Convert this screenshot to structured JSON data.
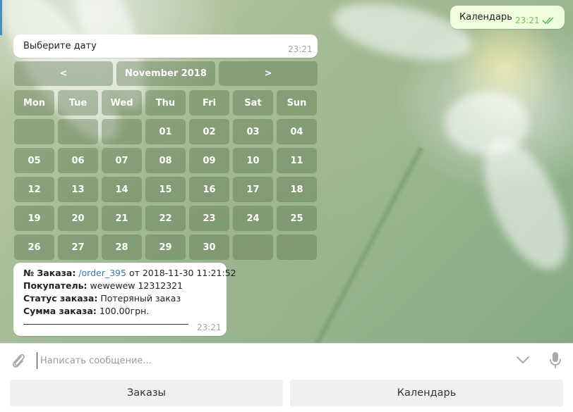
{
  "outgoing": {
    "text": "Календарь",
    "time": "23:21",
    "status_icon": "double-check-icon"
  },
  "prompt_message": {
    "text": "Выберите дату",
    "time": "23:21"
  },
  "calendar": {
    "prev": "<",
    "month": "November 2018",
    "next": ">",
    "weekdays": [
      "Mon",
      "Tue",
      "Wed",
      "Thu",
      "Fri",
      "Sat",
      "Sun"
    ],
    "weeks": [
      [
        "",
        "",
        "",
        "01",
        "02",
        "03",
        "04"
      ],
      [
        "05",
        "06",
        "07",
        "08",
        "09",
        "10",
        "11"
      ],
      [
        "12",
        "13",
        "14",
        "15",
        "16",
        "17",
        "18"
      ],
      [
        "19",
        "20",
        "21",
        "22",
        "23",
        "24",
        "25"
      ],
      [
        "26",
        "27",
        "28",
        "29",
        "30",
        "",
        ""
      ]
    ]
  },
  "order": {
    "number_label": "№ Заказа:",
    "number_link": "/order_395",
    "number_suffix": "от 2018-11-30 11:21:52",
    "buyer_label": "Покупатель:",
    "buyer_value": "wewewew 12312321",
    "status_label": "Статус заказа:",
    "status_value": "Потеряный заказ",
    "sum_label": "Сумма заказа:",
    "sum_value": "100.00грн.",
    "time": "23:21"
  },
  "composer": {
    "placeholder": "Написать сообщение...",
    "attach_icon": "paperclip-icon",
    "scroll_icon": "chevron-down-icon",
    "mic_icon": "microphone-icon"
  },
  "reply_keyboard": {
    "left": "Заказы",
    "right": "Календарь"
  }
}
